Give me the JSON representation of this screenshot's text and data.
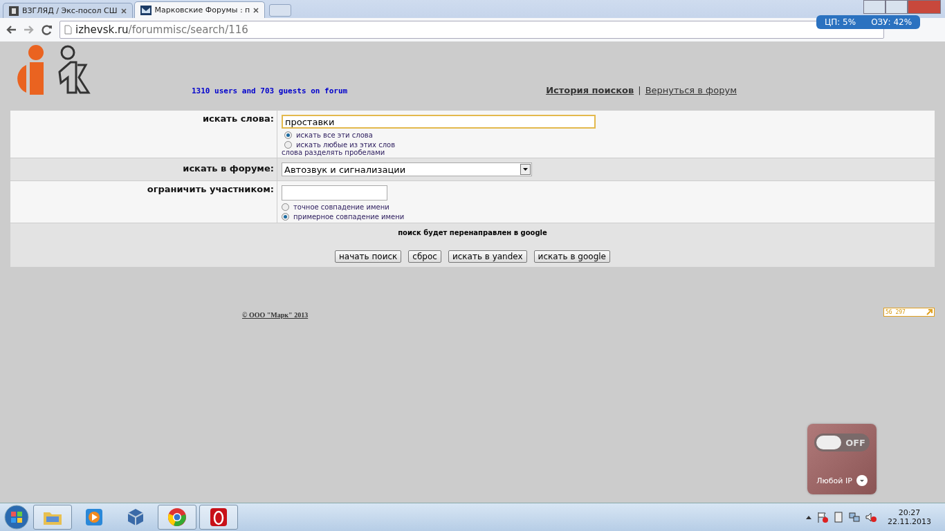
{
  "browser": {
    "tabs": [
      {
        "title": "ВЗГЛЯД / Экс-посол СШ",
        "kind": "letter",
        "selected": false
      },
      {
        "title": "Марковские Форумы : п",
        "kind": "envelope",
        "selected": true
      }
    ],
    "address": {
      "host": "izhevsk.ru",
      "path": "/forummisc/search/116"
    }
  },
  "monitor": {
    "cpu": "ЦП: 5%",
    "ram": "ОЗУ: 42%"
  },
  "header": {
    "online": "1310 users and 703 guests on forum",
    "links": [
      {
        "label": "История поисков",
        "bold": true
      },
      {
        "label": "Вернуться в форум",
        "bold": false
      }
    ],
    "separator": "|"
  },
  "form": {
    "words": {
      "label": "искать слова:",
      "value": "проставки",
      "options": [
        {
          "label": "искать все эти слова",
          "selected": true
        },
        {
          "label": "искать любые из этих слов",
          "selected": false
        }
      ],
      "hint": "слова разделять пробелами"
    },
    "forum": {
      "label": "искать в форуме:",
      "value": "Автозвук и сигнализации"
    },
    "member": {
      "label": "ограничить участником:",
      "options": [
        {
          "label": "точное совпадение имени",
          "selected": false
        },
        {
          "label": "примерное совпадение имени",
          "selected": true
        }
      ]
    },
    "notice": "поиск будет перенаправлен в google",
    "buttons": [
      "начать поиск",
      "сброс",
      "искать в yandex",
      "искать в google"
    ]
  },
  "footer": {
    "copyright": "© ООО \"Марк\" 2013",
    "counter": "56 297"
  },
  "vpn": {
    "on": false,
    "state_label": "OFF",
    "location": "Любой IP"
  },
  "taskbar": {
    "apps": [
      {
        "kind": "folder",
        "running": true
      },
      {
        "kind": "media",
        "running": false
      },
      {
        "kind": "cube",
        "running": false
      },
      {
        "kind": "chrome",
        "running": true
      },
      {
        "kind": "opera",
        "running": true
      }
    ],
    "time": "20:27",
    "date": "22.11.2013"
  }
}
